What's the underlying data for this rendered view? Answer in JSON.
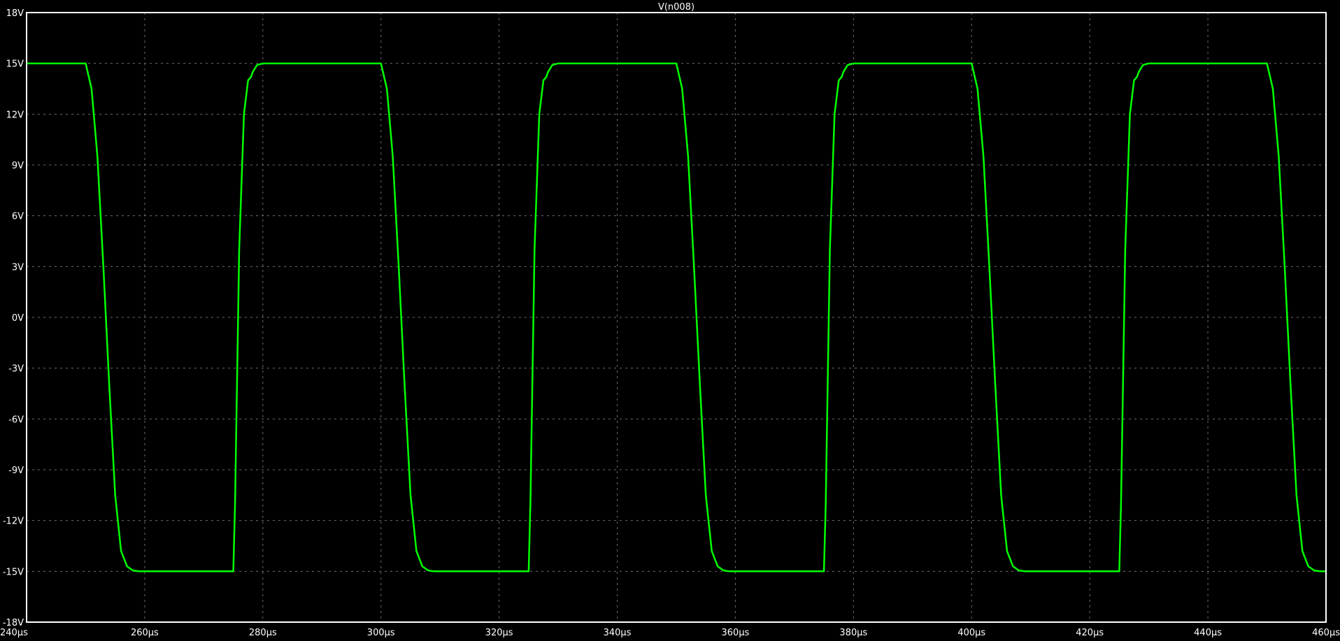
{
  "window": {
    "trace_label": "V(n008)"
  },
  "colors": {
    "background": "#000000",
    "frame": "#ffffff",
    "grid": "#6e6e6e",
    "trace": "#00ff00",
    "text": "#ffffff"
  },
  "chart_data": {
    "type": "line",
    "title": "V(n008)",
    "xlabel": "",
    "ylabel": "",
    "xlim": [
      240,
      460
    ],
    "ylim": [
      -18,
      18
    ],
    "x_unit": "µs",
    "y_unit": "V",
    "grid": true,
    "x_ticks": [
      "240µs",
      "260µs",
      "280µs",
      "300µs",
      "320µs",
      "340µs",
      "360µs",
      "380µs",
      "400µs",
      "420µs",
      "440µs",
      "460µs"
    ],
    "y_ticks": [
      "18V",
      "15V",
      "12V",
      "9V",
      "6V",
      "3V",
      "0V",
      "-3V",
      "-6V",
      "-9V",
      "-12V",
      "-15V",
      "-18V"
    ],
    "series": [
      {
        "name": "V(n008)",
        "x": [
          240,
          250.0,
          251.0,
          252.0,
          253.0,
          254.0,
          255.0,
          256.0,
          257.0,
          258.0,
          259.0,
          260.0,
          275.0,
          275.3,
          276.0,
          276.8,
          277.5,
          278.0,
          278.3,
          279.0,
          280.0,
          281.0,
          282.0,
          300.0,
          301.0,
          302.0,
          303.0,
          304.0,
          305.0,
          306.0,
          307.0,
          308.0,
          309.0,
          310.0,
          325.0,
          325.3,
          326.0,
          326.8,
          327.5,
          328.0,
          328.3,
          329.0,
          330.0,
          331.0,
          332.0,
          350.0,
          351.0,
          352.0,
          353.0,
          354.0,
          355.0,
          356.0,
          357.0,
          358.0,
          359.0,
          360.0,
          375.0,
          375.3,
          376.0,
          376.8,
          377.5,
          378.0,
          378.3,
          379.0,
          380.0,
          381.0,
          382.0,
          400.0,
          401.0,
          402.0,
          403.0,
          404.0,
          405.0,
          406.0,
          407.0,
          408.0,
          409.0,
          410.0,
          425.0,
          425.3,
          426.0,
          426.8,
          427.5,
          428.0,
          428.3,
          429.0,
          430.0,
          431.0,
          432.0,
          450.0,
          451.0,
          452.0,
          453.0,
          454.0,
          455.0,
          456.0,
          457.0,
          458.0,
          459.0,
          460.0
        ],
        "y": [
          15,
          15,
          13.5,
          9.5,
          3.0,
          -4.0,
          -10.5,
          -13.8,
          -14.7,
          -14.95,
          -15,
          -15,
          -15,
          -11.0,
          4.0,
          12.0,
          14.0,
          14.2,
          14.5,
          14.9,
          15,
          15,
          15,
          15,
          13.5,
          9.5,
          3.0,
          -4.0,
          -10.5,
          -13.8,
          -14.7,
          -14.95,
          -15,
          -15,
          -15,
          -11.0,
          4.0,
          12.0,
          14.0,
          14.2,
          14.5,
          14.9,
          15,
          15,
          15,
          15,
          13.5,
          9.5,
          3.0,
          -4.0,
          -10.5,
          -13.8,
          -14.7,
          -14.95,
          -15,
          -15,
          -15,
          -11.0,
          4.0,
          12.0,
          14.0,
          14.2,
          14.5,
          14.9,
          15,
          15,
          15,
          15,
          13.5,
          9.5,
          3.0,
          -4.0,
          -10.5,
          -13.8,
          -14.7,
          -14.95,
          -15,
          -15,
          -15,
          -11.0,
          4.0,
          12.0,
          14.0,
          14.2,
          14.5,
          14.9,
          15,
          15,
          15,
          15,
          13.5,
          9.5,
          3.0,
          -4.0,
          -10.5,
          -13.8,
          -14.7,
          -14.95,
          -15,
          -15
        ]
      }
    ]
  }
}
